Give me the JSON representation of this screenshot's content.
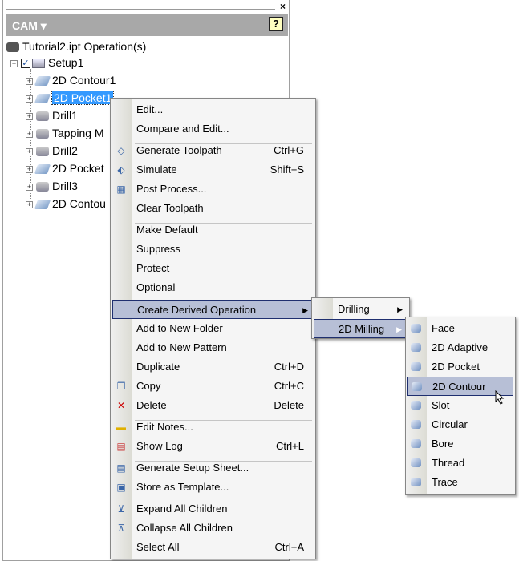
{
  "panel": {
    "title": "CAM",
    "title_arrow": "▾",
    "help": "?",
    "close": "×"
  },
  "tree": {
    "root": "Tutorial2.ipt Operation(s)",
    "setup": "Setup1",
    "items": [
      "2D Contour1",
      "2D Pocket1",
      "Drill1",
      "Tapping M",
      "Drill2",
      "2D Pocket",
      "Drill3",
      "2D Contou"
    ],
    "icons": [
      "contour",
      "pocket",
      "drill",
      "drill",
      "drill",
      "pocket",
      "drill",
      "contour"
    ]
  },
  "context_menu": {
    "items": [
      {
        "label": "Edit..."
      },
      {
        "label": "Compare and Edit..."
      },
      {
        "label": "Generate Toolpath",
        "shortcut": "Ctrl+G",
        "icon": "toolpath-icon"
      },
      {
        "label": "Simulate",
        "shortcut": "Shift+S",
        "icon": "simulate-icon"
      },
      {
        "label": "Post Process...",
        "icon": "post-process-icon"
      },
      {
        "label": "Clear Toolpath"
      },
      {
        "label": "Make Default"
      },
      {
        "label": "Suppress"
      },
      {
        "label": "Protect"
      },
      {
        "label": "Optional"
      },
      {
        "label": "Create Derived Operation",
        "submenu": true
      },
      {
        "label": "Add to New Folder"
      },
      {
        "label": "Add to New Pattern"
      },
      {
        "label": "Duplicate",
        "shortcut": "Ctrl+D"
      },
      {
        "label": "Copy",
        "shortcut": "Ctrl+C",
        "icon": "copy-icon"
      },
      {
        "label": "Delete",
        "shortcut": "Delete",
        "icon": "delete-icon"
      },
      {
        "label": "Edit Notes...",
        "icon": "notes-icon"
      },
      {
        "label": "Show Log",
        "shortcut": "Ctrl+L",
        "icon": "log-icon"
      },
      {
        "label": "Generate Setup Sheet...",
        "icon": "setup-sheet-icon"
      },
      {
        "label": "Store as Template...",
        "icon": "template-icon"
      },
      {
        "label": "Expand All Children",
        "icon": "expand-icon"
      },
      {
        "label": "Collapse All Children",
        "icon": "collapse-icon"
      },
      {
        "label": "Select All",
        "shortcut": "Ctrl+A"
      }
    ]
  },
  "submenu1": {
    "items": [
      "Drilling",
      "2D Milling"
    ]
  },
  "submenu2": {
    "items": [
      "Face",
      "2D Adaptive",
      "2D Pocket",
      "2D Contour",
      "Slot",
      "Circular",
      "Bore",
      "Thread",
      "Trace"
    ],
    "selected": "2D Contour"
  }
}
